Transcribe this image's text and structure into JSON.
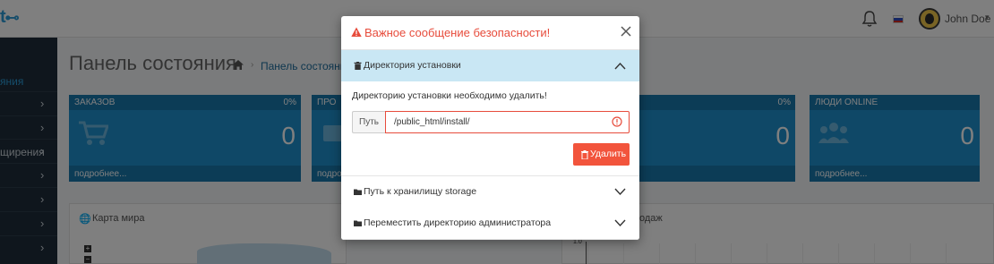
{
  "topbar": {
    "logo_text": "t",
    "logo_icon": "cart-icon",
    "bell_icon": "bell-icon",
    "language_flag": "ru-flag-icon",
    "username": "John Doe"
  },
  "sidebar": {
    "items": [
      {
        "label": "яния",
        "active": true
      },
      {
        "label": "",
        "active": false
      },
      {
        "label": "",
        "active": false
      },
      {
        "label": "щирения",
        "active": false
      },
      {
        "label": "",
        "active": false
      },
      {
        "label": "",
        "active": false
      },
      {
        "label": "",
        "active": false
      },
      {
        "label": "",
        "active": false
      }
    ]
  },
  "page": {
    "title": "Панель состояния",
    "breadcrumb": "Панель состояния"
  },
  "tiles": [
    {
      "title": "ЗАКАЗОВ",
      "percent": "0%",
      "value": "0",
      "footer": "подробнее...",
      "icon": "cart-icon"
    },
    {
      "title": "ПРО",
      "percent": "",
      "value": "",
      "footer": "подробнее...",
      "icon": "card-icon"
    },
    {
      "title": "",
      "percent": "0%",
      "value": "0",
      "footer": "",
      "icon": ""
    },
    {
      "title": "ЛЮДИ ONLINE",
      "percent": "",
      "value": "0",
      "footer": "подробнее...",
      "icon": "users-icon"
    }
  ],
  "panels": {
    "map_title": "Карта мира",
    "map_zoom_in": "+",
    "map_zoom_out": "−",
    "sales_title": "одаж",
    "sales_tick": "1.0"
  },
  "modal": {
    "title": "Важное сообщение безопасности!",
    "sections": [
      {
        "title": "Директория установки",
        "icon": "trash-icon",
        "expanded": true,
        "message": "Директорию установки необходимо удалить!",
        "path_label": "Путь",
        "path_value": "/public_html/install/",
        "delete_label": "Удалить"
      },
      {
        "title": "Путь к хранилищу storage",
        "icon": "folder-icon",
        "expanded": false
      },
      {
        "title": "Переместить директорию администратора",
        "icon": "folder-icon",
        "expanded": false
      }
    ],
    "colors": {
      "title": "#e74c3c",
      "active_section_bg": "#c9e7f4",
      "delete_button": "#f2543c"
    }
  }
}
